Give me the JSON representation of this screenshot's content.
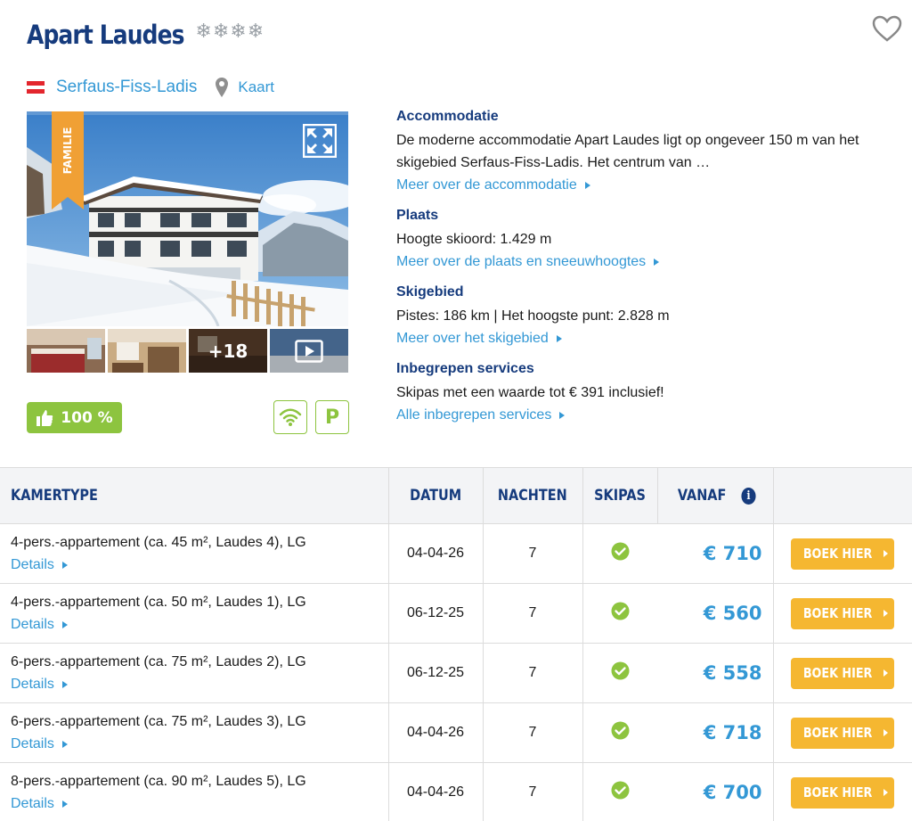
{
  "accommodation": {
    "name": "Apart Laudes",
    "stars": "❄❄❄❄"
  },
  "location": {
    "resort": "Serfaus-Fiss-Ladis",
    "map_label": "Kaart",
    "flag_colors": [
      "#e3262d",
      "#ffffff",
      "#e3262d"
    ]
  },
  "media": {
    "badge": "FAMILIE",
    "more_photos": "+18"
  },
  "rating": {
    "score": "100 %"
  },
  "facilities": {
    "parking_label": "P"
  },
  "sections": [
    {
      "heading": "Accommodatie",
      "text": "De moderne accommodatie Apart Laudes ligt op ongeveer 150 m van het skigebied Serfaus-Fiss-Ladis. Het centrum van …",
      "link": "Meer over de accommodatie"
    },
    {
      "heading": "Plaats",
      "text": "Hoogte skioord: 1.429 m",
      "link": "Meer over de plaats en sneeuwhoogtes"
    },
    {
      "heading": "Skigebied",
      "text": "Pistes: 186 km | Het hoogste punt: 2.828 m",
      "link": "Meer over het skigebied"
    },
    {
      "heading": "Inbegrepen services",
      "text": "Skipas met een waarde tot € 391 inclusief!",
      "link": "Alle inbegrepen services"
    }
  ],
  "table": {
    "headers": {
      "room_type": "KAMERTYPE",
      "date": "DATUM",
      "nights": "NACHTEN",
      "skipass": "SKIPAS",
      "from": "VANAF",
      "info_icon": "i"
    },
    "details_label": "Details",
    "book_label": "BOEK HIER",
    "rows": [
      {
        "room": "4-pers.-appartement (ca. 45 m², Laudes 4), LG",
        "date": "04-04-26",
        "nights": "7",
        "skipass_included": true,
        "price": "€ 710"
      },
      {
        "room": "4-pers.-appartement (ca. 50 m², Laudes 1), LG",
        "date": "06-12-25",
        "nights": "7",
        "skipass_included": true,
        "price": "€ 560"
      },
      {
        "room": "6-pers.-appartement (ca. 75 m², Laudes 2), LG",
        "date": "06-12-25",
        "nights": "7",
        "skipass_included": true,
        "price": "€ 558"
      },
      {
        "room": "6-pers.-appartement (ca. 75 m², Laudes 3), LG",
        "date": "04-04-26",
        "nights": "7",
        "skipass_included": true,
        "price": "€ 718"
      },
      {
        "room": "8-pers.-appartement (ca. 90 m², Laudes 5), LG",
        "date": "04-04-26",
        "nights": "7",
        "skipass_included": true,
        "price": "€ 700"
      }
    ]
  },
  "colors": {
    "brand_blue": "#163b7d",
    "link_blue": "#3398d5",
    "green": "#8dc43f",
    "book_orange": "#f5b731",
    "ribbon_orange": "#f0a035"
  }
}
